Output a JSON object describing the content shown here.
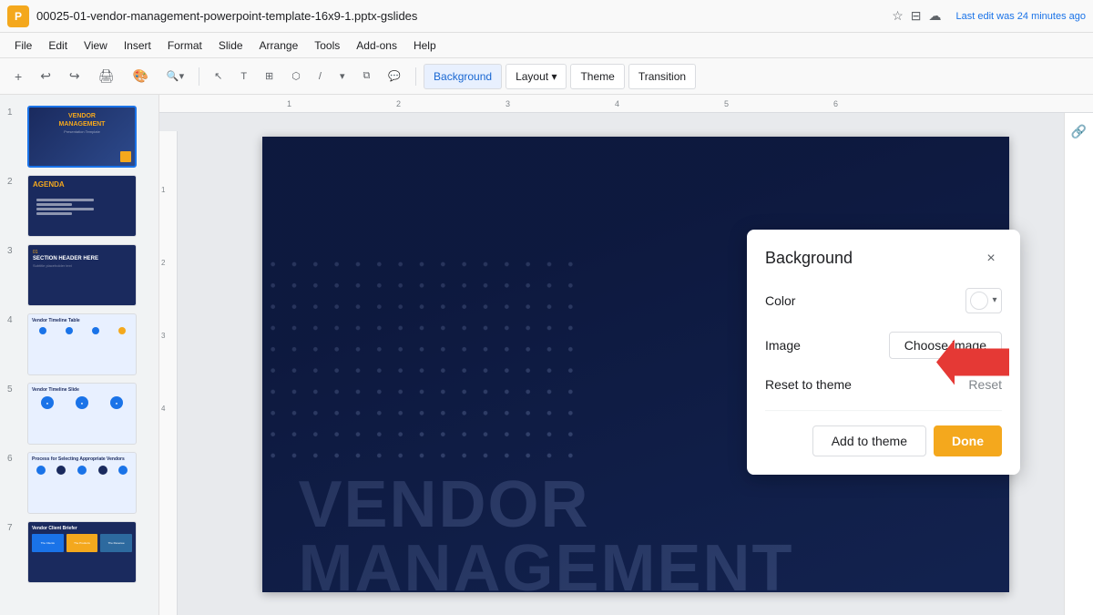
{
  "titlebar": {
    "filename": "00025-01-vendor-management-powerpoint-template-16x9-1.pptx-gslides",
    "app_icon": "P",
    "edit_status": "Last edit was 24 minutes ago"
  },
  "menubar": {
    "items": [
      "File",
      "Edit",
      "View",
      "Insert",
      "Format",
      "Slide",
      "Arrange",
      "Tools",
      "Add-ons",
      "Help"
    ]
  },
  "toolbar": {
    "background_label": "Background",
    "layout_label": "Layout",
    "theme_label": "Theme",
    "transition_label": "Transition"
  },
  "dialog": {
    "title": "Background",
    "close_icon": "×",
    "color_label": "Color",
    "image_label": "Image",
    "choose_image_label": "Choose image",
    "reset_to_theme_label": "Reset to theme",
    "reset_label": "Reset",
    "add_to_theme_label": "Add to theme",
    "done_label": "Done"
  },
  "slides": [
    {
      "number": "1",
      "type": "title",
      "active": true
    },
    {
      "number": "2",
      "type": "agenda"
    },
    {
      "number": "3",
      "type": "section"
    },
    {
      "number": "4",
      "type": "timeline"
    },
    {
      "number": "5",
      "type": "timeline2"
    },
    {
      "number": "6",
      "type": "process"
    },
    {
      "number": "7",
      "type": "chart"
    }
  ],
  "slide_main": {
    "vendor_text": "VENDOR",
    "management_text": "MANAGEMENT"
  },
  "ruler": {
    "marks": [
      "1",
      "2",
      "3",
      "4",
      "5",
      "6"
    ]
  }
}
